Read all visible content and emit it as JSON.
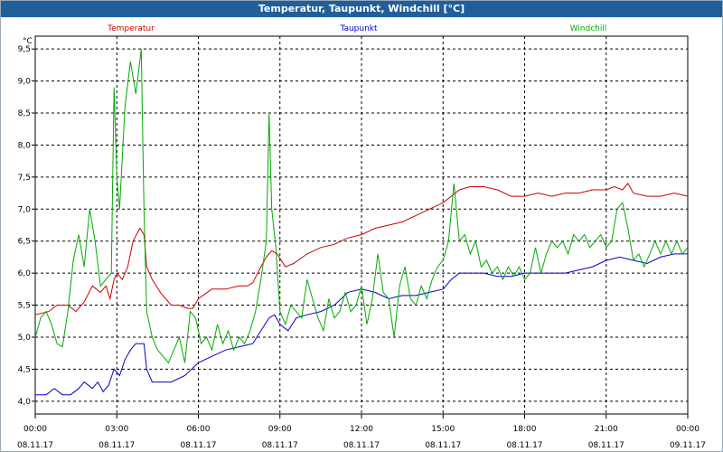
{
  "window": {
    "title": "Temperatur, Taupunkt, Windchill [°C]"
  },
  "chart_data": {
    "type": "line",
    "title": "Temperatur, Taupunkt, Windchill [°C]",
    "ylabel": "°C",
    "ylim": [
      3.8,
      9.7
    ],
    "yticks": [
      "4,0",
      "4,5",
      "5,0",
      "5,5",
      "6,0",
      "6,5",
      "7,0",
      "7,5",
      "8,0",
      "8,5",
      "9,0",
      "9,5"
    ],
    "xlim": [
      0,
      24
    ],
    "xticks": [
      {
        "time": "00:00",
        "date": "08.11.17"
      },
      {
        "time": "03:00",
        "date": "08.11.17"
      },
      {
        "time": "06:00",
        "date": "08.11.17"
      },
      {
        "time": "09:00",
        "date": "08.11.17"
      },
      {
        "time": "12:00",
        "date": "08.11.17"
      },
      {
        "time": "15:00",
        "date": "08.11.17"
      },
      {
        "time": "18:00",
        "date": "08.11.17"
      },
      {
        "time": "21:00",
        "date": "08.11.17"
      },
      {
        "time": "00:00",
        "date": "09.11.17"
      }
    ],
    "grid": true,
    "legend_placement": "top",
    "series": [
      {
        "name": "Temperatur",
        "color": "#cc0000",
        "points": [
          [
            0,
            5.35
          ],
          [
            0.5,
            5.4
          ],
          [
            0.8,
            5.5
          ],
          [
            1.2,
            5.5
          ],
          [
            1.5,
            5.4
          ],
          [
            1.8,
            5.55
          ],
          [
            2.1,
            5.8
          ],
          [
            2.4,
            5.7
          ],
          [
            2.6,
            5.8
          ],
          [
            2.75,
            5.6
          ],
          [
            2.9,
            5.9
          ],
          [
            3.0,
            6.0
          ],
          [
            3.2,
            5.9
          ],
          [
            3.4,
            6.1
          ],
          [
            3.6,
            6.5
          ],
          [
            3.85,
            6.7
          ],
          [
            4.0,
            6.6
          ],
          [
            4.1,
            6.1
          ],
          [
            4.3,
            5.9
          ],
          [
            4.6,
            5.7
          ],
          [
            5.0,
            5.5
          ],
          [
            5.3,
            5.5
          ],
          [
            5.6,
            5.45
          ],
          [
            5.8,
            5.45
          ],
          [
            6.0,
            5.6
          ],
          [
            6.5,
            5.75
          ],
          [
            7.0,
            5.75
          ],
          [
            7.5,
            5.8
          ],
          [
            7.8,
            5.8
          ],
          [
            8.0,
            5.85
          ],
          [
            8.3,
            6.1
          ],
          [
            8.5,
            6.25
          ],
          [
            8.7,
            6.35
          ],
          [
            8.9,
            6.3
          ],
          [
            9.2,
            6.1
          ],
          [
            9.5,
            6.15
          ],
          [
            10.0,
            6.3
          ],
          [
            10.5,
            6.4
          ],
          [
            11.0,
            6.45
          ],
          [
            11.5,
            6.55
          ],
          [
            12.0,
            6.6
          ],
          [
            12.5,
            6.7
          ],
          [
            13.0,
            6.75
          ],
          [
            13.5,
            6.8
          ],
          [
            14.0,
            6.9
          ],
          [
            14.5,
            7.0
          ],
          [
            15.0,
            7.1
          ],
          [
            15.3,
            7.2
          ],
          [
            15.6,
            7.3
          ],
          [
            16.0,
            7.35
          ],
          [
            16.5,
            7.35
          ],
          [
            17.0,
            7.3
          ],
          [
            17.5,
            7.2
          ],
          [
            18.0,
            7.2
          ],
          [
            18.5,
            7.25
          ],
          [
            19.0,
            7.2
          ],
          [
            19.5,
            7.25
          ],
          [
            20.0,
            7.25
          ],
          [
            20.5,
            7.3
          ],
          [
            21.0,
            7.3
          ],
          [
            21.3,
            7.35
          ],
          [
            21.6,
            7.3
          ],
          [
            21.8,
            7.4
          ],
          [
            22.0,
            7.25
          ],
          [
            22.5,
            7.2
          ],
          [
            23.0,
            7.2
          ],
          [
            23.5,
            7.25
          ],
          [
            24.0,
            7.2
          ]
        ]
      },
      {
        "name": "Taupunkt",
        "color": "#0000cc",
        "points": [
          [
            0,
            4.1
          ],
          [
            0.4,
            4.1
          ],
          [
            0.7,
            4.2
          ],
          [
            1.0,
            4.1
          ],
          [
            1.3,
            4.1
          ],
          [
            1.6,
            4.2
          ],
          [
            1.8,
            4.3
          ],
          [
            2.1,
            4.2
          ],
          [
            2.3,
            4.3
          ],
          [
            2.5,
            4.15
          ],
          [
            2.7,
            4.25
          ],
          [
            2.9,
            4.5
          ],
          [
            3.1,
            4.4
          ],
          [
            3.3,
            4.65
          ],
          [
            3.5,
            4.8
          ],
          [
            3.7,
            4.9
          ],
          [
            4.0,
            4.9
          ],
          [
            4.1,
            4.5
          ],
          [
            4.3,
            4.3
          ],
          [
            5.0,
            4.3
          ],
          [
            5.5,
            4.4
          ],
          [
            6.0,
            4.6
          ],
          [
            6.5,
            4.7
          ],
          [
            7.0,
            4.8
          ],
          [
            7.5,
            4.85
          ],
          [
            8.0,
            4.9
          ],
          [
            8.3,
            5.1
          ],
          [
            8.6,
            5.3
          ],
          [
            8.8,
            5.35
          ],
          [
            9.0,
            5.2
          ],
          [
            9.3,
            5.1
          ],
          [
            9.6,
            5.3
          ],
          [
            10.0,
            5.35
          ],
          [
            10.5,
            5.4
          ],
          [
            11.0,
            5.5
          ],
          [
            11.5,
            5.7
          ],
          [
            12.0,
            5.75
          ],
          [
            12.5,
            5.7
          ],
          [
            13.0,
            5.6
          ],
          [
            13.5,
            5.65
          ],
          [
            14.0,
            5.65
          ],
          [
            14.5,
            5.7
          ],
          [
            15.0,
            5.75
          ],
          [
            15.3,
            5.9
          ],
          [
            15.6,
            6.0
          ],
          [
            16.0,
            6.0
          ],
          [
            16.5,
            6.0
          ],
          [
            17.0,
            5.95
          ],
          [
            17.5,
            5.95
          ],
          [
            18.0,
            6.0
          ],
          [
            18.5,
            6.0
          ],
          [
            19.0,
            6.0
          ],
          [
            19.5,
            6.0
          ],
          [
            20.0,
            6.05
          ],
          [
            20.5,
            6.1
          ],
          [
            21.0,
            6.2
          ],
          [
            21.5,
            6.25
          ],
          [
            22.0,
            6.2
          ],
          [
            22.5,
            6.15
          ],
          [
            23.0,
            6.25
          ],
          [
            23.5,
            6.3
          ],
          [
            24.0,
            6.3
          ]
        ]
      },
      {
        "name": "Windchill",
        "color": "#00aa00",
        "points": [
          [
            0,
            5.0
          ],
          [
            0.2,
            5.3
          ],
          [
            0.4,
            5.4
          ],
          [
            0.6,
            5.2
          ],
          [
            0.8,
            4.9
          ],
          [
            1.0,
            4.85
          ],
          [
            1.2,
            5.4
          ],
          [
            1.4,
            6.2
          ],
          [
            1.6,
            6.6
          ],
          [
            1.8,
            6.1
          ],
          [
            2.0,
            7.0
          ],
          [
            2.2,
            6.5
          ],
          [
            2.4,
            5.8
          ],
          [
            2.6,
            5.9
          ],
          [
            2.8,
            6.0
          ],
          [
            2.9,
            8.9
          ],
          [
            3.0,
            7.5
          ],
          [
            3.1,
            7.0
          ],
          [
            3.3,
            8.6
          ],
          [
            3.5,
            9.3
          ],
          [
            3.7,
            8.8
          ],
          [
            3.9,
            9.5
          ],
          [
            4.0,
            7.0
          ],
          [
            4.1,
            5.4
          ],
          [
            4.3,
            5.0
          ],
          [
            4.5,
            4.8
          ],
          [
            4.7,
            4.7
          ],
          [
            4.9,
            4.6
          ],
          [
            5.1,
            4.8
          ],
          [
            5.3,
            5.0
          ],
          [
            5.5,
            4.6
          ],
          [
            5.7,
            5.4
          ],
          [
            5.9,
            5.3
          ],
          [
            6.1,
            4.9
          ],
          [
            6.3,
            5.0
          ],
          [
            6.5,
            4.8
          ],
          [
            6.7,
            5.2
          ],
          [
            6.9,
            4.9
          ],
          [
            7.1,
            5.1
          ],
          [
            7.3,
            4.8
          ],
          [
            7.5,
            5.0
          ],
          [
            7.7,
            4.9
          ],
          [
            7.9,
            5.1
          ],
          [
            8.1,
            5.4
          ],
          [
            8.3,
            5.9
          ],
          [
            8.5,
            6.5
          ],
          [
            8.6,
            8.5
          ],
          [
            8.7,
            7.0
          ],
          [
            8.85,
            6.4
          ],
          [
            9.0,
            5.4
          ],
          [
            9.2,
            5.2
          ],
          [
            9.4,
            5.5
          ],
          [
            9.6,
            5.4
          ],
          [
            9.8,
            5.3
          ],
          [
            10.0,
            5.9
          ],
          [
            10.2,
            5.6
          ],
          [
            10.4,
            5.3
          ],
          [
            10.6,
            5.1
          ],
          [
            10.8,
            5.6
          ],
          [
            11.0,
            5.3
          ],
          [
            11.2,
            5.4
          ],
          [
            11.4,
            5.7
          ],
          [
            11.6,
            5.4
          ],
          [
            11.8,
            5.5
          ],
          [
            12.0,
            5.8
          ],
          [
            12.2,
            5.2
          ],
          [
            12.4,
            5.6
          ],
          [
            12.6,
            6.3
          ],
          [
            12.8,
            5.7
          ],
          [
            13.0,
            5.6
          ],
          [
            13.2,
            5.0
          ],
          [
            13.4,
            5.8
          ],
          [
            13.6,
            6.1
          ],
          [
            13.8,
            5.6
          ],
          [
            14.0,
            5.5
          ],
          [
            14.2,
            5.8
          ],
          [
            14.4,
            5.6
          ],
          [
            14.6,
            5.9
          ],
          [
            14.8,
            6.1
          ],
          [
            15.0,
            6.2
          ],
          [
            15.2,
            6.5
          ],
          [
            15.4,
            7.4
          ],
          [
            15.6,
            6.5
          ],
          [
            15.8,
            6.6
          ],
          [
            16.0,
            6.3
          ],
          [
            16.2,
            6.5
          ],
          [
            16.4,
            6.1
          ],
          [
            16.6,
            6.2
          ],
          [
            16.8,
            6.0
          ],
          [
            17.0,
            6.1
          ],
          [
            17.2,
            5.9
          ],
          [
            17.4,
            6.1
          ],
          [
            17.6,
            5.95
          ],
          [
            17.8,
            6.1
          ],
          [
            18.0,
            5.9
          ],
          [
            18.2,
            6.0
          ],
          [
            18.4,
            6.4
          ],
          [
            18.6,
            6.0
          ],
          [
            18.8,
            6.3
          ],
          [
            19.0,
            6.5
          ],
          [
            19.2,
            6.4
          ],
          [
            19.4,
            6.5
          ],
          [
            19.6,
            6.3
          ],
          [
            19.8,
            6.6
          ],
          [
            20.0,
            6.5
          ],
          [
            20.2,
            6.6
          ],
          [
            20.4,
            6.4
          ],
          [
            20.6,
            6.5
          ],
          [
            20.8,
            6.6
          ],
          [
            21.0,
            6.4
          ],
          [
            21.2,
            6.5
          ],
          [
            21.4,
            7.0
          ],
          [
            21.6,
            7.1
          ],
          [
            21.8,
            6.7
          ],
          [
            22.0,
            6.2
          ],
          [
            22.2,
            6.3
          ],
          [
            22.4,
            6.1
          ],
          [
            22.6,
            6.3
          ],
          [
            22.8,
            6.5
          ],
          [
            23.0,
            6.3
          ],
          [
            23.2,
            6.5
          ],
          [
            23.4,
            6.3
          ],
          [
            23.6,
            6.5
          ],
          [
            23.8,
            6.3
          ],
          [
            24.0,
            6.4
          ]
        ]
      }
    ]
  }
}
